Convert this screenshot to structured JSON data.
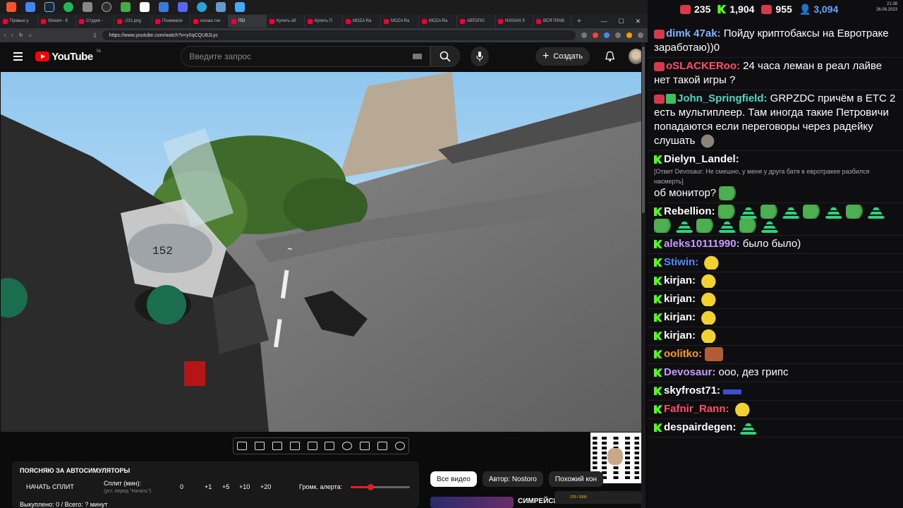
{
  "browser": {
    "tabs": [
      {
        "label": "Правые у"
      },
      {
        "label": "Stream - K"
      },
      {
        "label": "Студия -"
      },
      {
        "label": "-221.png"
      },
      {
        "label": "Понимали"
      },
      {
        "label": "калаш гон"
      },
      {
        "label": "ПО"
      },
      {
        "label": "Купить об"
      },
      {
        "label": "Купить П"
      },
      {
        "label": "MOZA Ra"
      },
      {
        "label": "MOZA Ra"
      },
      {
        "label": "MOZA Ra"
      },
      {
        "label": "АВТОПО"
      },
      {
        "label": "NISSAN S"
      },
      {
        "label": "ВСЯ ПРАВ"
      }
    ],
    "url": "https://www.youtube.com/watch?v=y0qCQU8JLyc"
  },
  "youtube": {
    "logo_text": "YouTube",
    "region": "NL",
    "search_placeholder": "Введите запрос",
    "create_label": "Создать"
  },
  "panel": {
    "title": "ПОЯСНЯЮ ЗА АВТОСИМУЛЯТОРЫ",
    "start_split": "НАЧАТЬ СПЛИТ",
    "split_label": "Сплит (мин):",
    "split_sub": "(уст. перед \"Начать\")",
    "split_value": "0",
    "increments": [
      "+1",
      "+5",
      "+10",
      "+20"
    ],
    "alert_label": "Громк. алерта:",
    "alert_volume_fraction": 0.33,
    "footer": "Выкуплено: 0 / Всего: ? минут"
  },
  "chips": [
    "Все видео",
    "Автор: Nostoro",
    "Похожий кон"
  ],
  "party_text": "270 / 1500",
  "rec_title": "СИМРЕЙСИ",
  "chat": {
    "stats": {
      "a": "235",
      "b": "1,904",
      "c": "955",
      "viewers": "3,094"
    },
    "clock": {
      "time": "21:38",
      "date": "26.08.2023"
    },
    "messages": [
      {
        "badge": "live",
        "nick": "dimk 47ak:",
        "color": "#7fb2ff",
        "text": "Пойду криптобаксы на Евротраке заработаю))0"
      },
      {
        "badge": "live",
        "nick": "oSLACKERoo:",
        "color": "#ff4d6a",
        "text": "24 часа леман в реал лайве нет такой игры ?"
      },
      {
        "badge": "live",
        "nick": "John_Springfield:",
        "color": "#4fd6c2",
        "text": "GRPZDC причём в ETC 2 есть мультиплеер. Там иногда такие Петровичи попадаются если переговоры через радейку слушать"
      },
      {
        "badge": "kick",
        "nick": "Dielyn_Landel:",
        "color": "#ffffff",
        "reply": "[Ответ Devosaur: Не смешно, у меня у друга батя в евротракее разбился насмерть]",
        "text": "об монитор?"
      },
      {
        "badge": "kick",
        "nick": "Rebellion:",
        "color": "#ffffff",
        "text": ""
      },
      {
        "badge": "kick",
        "nick": "aleks10111990:",
        "color": "#c79bff",
        "text": "было было)"
      },
      {
        "badge": "kick",
        "nick": "Stiwin:",
        "color": "#4b8bff",
        "text": ""
      },
      {
        "badge": "kick",
        "nick": "kirjan:",
        "color": "#ffffff",
        "text": ""
      },
      {
        "badge": "kick",
        "nick": "kirjan:",
        "color": "#ffffff",
        "text": ""
      },
      {
        "badge": "kick",
        "nick": "kirjan:",
        "color": "#ffffff",
        "text": ""
      },
      {
        "badge": "kick",
        "nick": "kirjan:",
        "color": "#ffffff",
        "text": ""
      },
      {
        "badge": "kick",
        "nick": "oolitko:",
        "color": "#ff9c1a",
        "text": ""
      },
      {
        "badge": "kick",
        "nick": "Devosaur:",
        "color": "#c79bff",
        "text": "ооо, дез грипс"
      },
      {
        "badge": "kick",
        "nick": "skyfrost71:",
        "color": "#ffffff",
        "text": ""
      },
      {
        "badge": "kick",
        "nick": "Fafnir_Rann:",
        "color": "#ff4d6a",
        "text": ""
      },
      {
        "badge": "kick",
        "nick": "despairdegen:",
        "color": "#ffffff",
        "text": ""
      }
    ]
  },
  "colors": {
    "accent": "#ff0000",
    "kick_green": "#53fc18",
    "chat_bg": "#0e0e10"
  }
}
